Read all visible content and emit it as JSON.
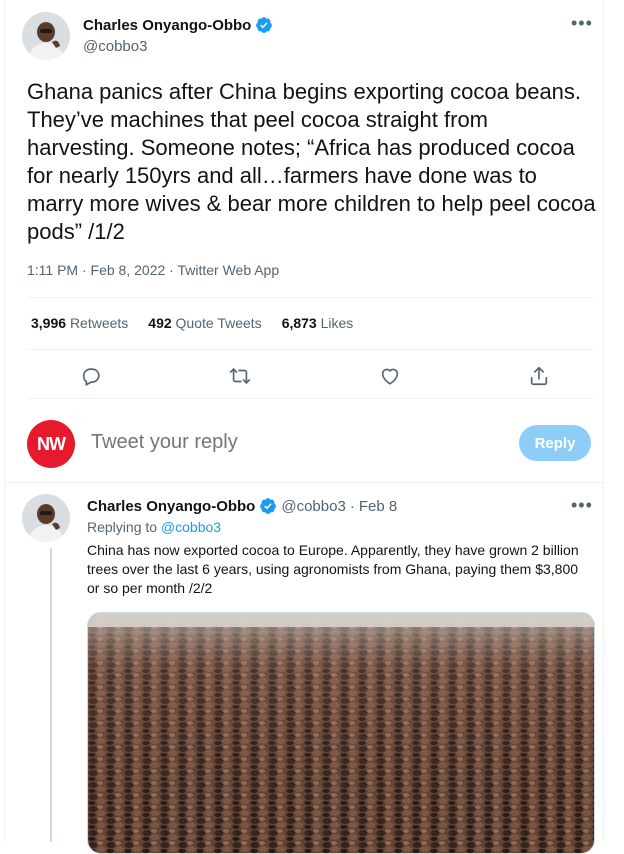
{
  "tweet": {
    "author_name": "Charles Onyango-Obbo",
    "author_handle": "@cobbo3",
    "text": "Ghana panics after China begins exporting cocoa beans. They’ve machines that peel cocoa straight from harvesting. Someone notes; “Africa has produced cocoa for nearly 150yrs and all…farmers have done was to marry more wives & bear more children to help peel cocoa pods” /1/2",
    "timestamp": "1:11 PM · Feb 8, 2022 · Twitter Web App",
    "more_label": "•••",
    "stats": {
      "retweets_count": "3,996",
      "retweets_label": "Retweets",
      "quotes_count": "492",
      "quotes_label": "Quote Tweets",
      "likes_count": "6,873",
      "likes_label": "Likes"
    },
    "actions": [
      "reply-icon",
      "retweet-icon",
      "like-icon",
      "share-icon"
    ]
  },
  "reply_box": {
    "avatar_text": "NW",
    "placeholder": "Tweet your reply",
    "button_label": "Reply"
  },
  "reply_tweet": {
    "author_name": "Charles Onyango-Obbo",
    "author_handle": "@cobbo3",
    "separator": "·",
    "date": "Feb 8",
    "replying_prefix": "Replying to",
    "replying_handle": "@cobbo3",
    "text": "China has now exported cocoa to Europe. Apparently, they have grown 2 billion trees over the last 6 years, using agronomists from Ghana, paying them $3,800 or so per month  /2/2",
    "more_label": "•••"
  },
  "colors": {
    "accent": "#1d9bf0",
    "reply_button": "#8ecdf8",
    "nw_avatar": "#e6192d",
    "muted_text": "#536471"
  }
}
